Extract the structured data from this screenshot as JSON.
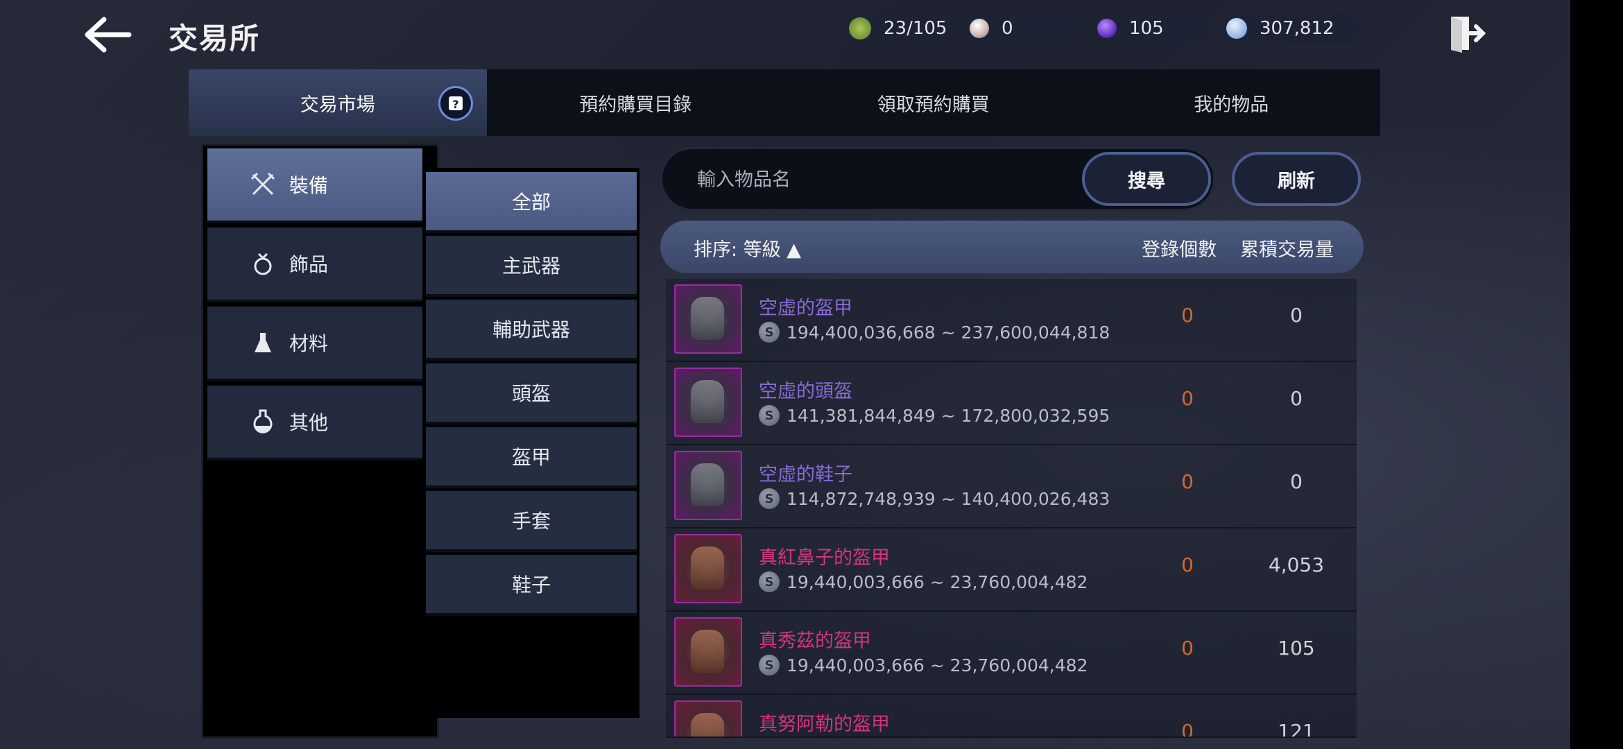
{
  "header": {
    "title": "交易所",
    "currencies": [
      {
        "icon": "green-seal-icon",
        "value": "23/105",
        "color": "#7fae3e"
      },
      {
        "icon": "pearl-icon",
        "value": "0",
        "color": "#d9c8c4"
      },
      {
        "icon": "purple-crystal-icon",
        "value": "105",
        "color": "#6c3fd1"
      },
      {
        "icon": "silver-coin-icon",
        "value": "307,812",
        "color": "#a9c4e6"
      }
    ]
  },
  "tabs": [
    {
      "label": "交易市場",
      "active": true
    },
    {
      "label": "預約購買目錄"
    },
    {
      "label": "領取預約購買"
    },
    {
      "label": "我的物品"
    }
  ],
  "categories": [
    {
      "label": "裝備",
      "icon": "crossed-swords-icon",
      "active": true
    },
    {
      "label": "飾品",
      "icon": "ring-icon"
    },
    {
      "label": "材料",
      "icon": "flask-icon"
    },
    {
      "label": "其他",
      "icon": "potion-icon"
    }
  ],
  "subcategories": [
    {
      "label": "全部",
      "active": true
    },
    {
      "label": "主武器"
    },
    {
      "label": "輔助武器"
    },
    {
      "label": "頭盔"
    },
    {
      "label": "盔甲"
    },
    {
      "label": "手套"
    },
    {
      "label": "鞋子"
    }
  ],
  "search": {
    "placeholder": "輸入物品名",
    "value": "",
    "search_label": "搜尋",
    "refresh_label": "刷新"
  },
  "list_header": {
    "sort": "排序: 等級 ▲",
    "count": "登錄個數",
    "volume": "累積交易量"
  },
  "items": [
    {
      "name": "空虛的盔甲",
      "price": "194,400,036,668 ~ 237,600,044,818",
      "count": "0",
      "volume": "0",
      "grade": "violet"
    },
    {
      "name": "空虛的頭盔",
      "price": "141,381,844,849 ~ 172,800,032,595",
      "count": "0",
      "volume": "0",
      "grade": "violet"
    },
    {
      "name": "空虛的鞋子",
      "price": "114,872,748,939 ~ 140,400,026,483",
      "count": "0",
      "volume": "0",
      "grade": "violet"
    },
    {
      "name": "真紅鼻子的盔甲",
      "price": "19,440,003,666 ~ 23,760,004,482",
      "count": "0",
      "volume": "4,053",
      "grade": "pink"
    },
    {
      "name": "真秀茲的盔甲",
      "price": "19,440,003,666 ~ 23,760,004,482",
      "count": "0",
      "volume": "105",
      "grade": "pink"
    },
    {
      "name": "真努阿勒的盔甲",
      "price": "",
      "count": "0",
      "volume": "121",
      "grade": "pink"
    }
  ]
}
